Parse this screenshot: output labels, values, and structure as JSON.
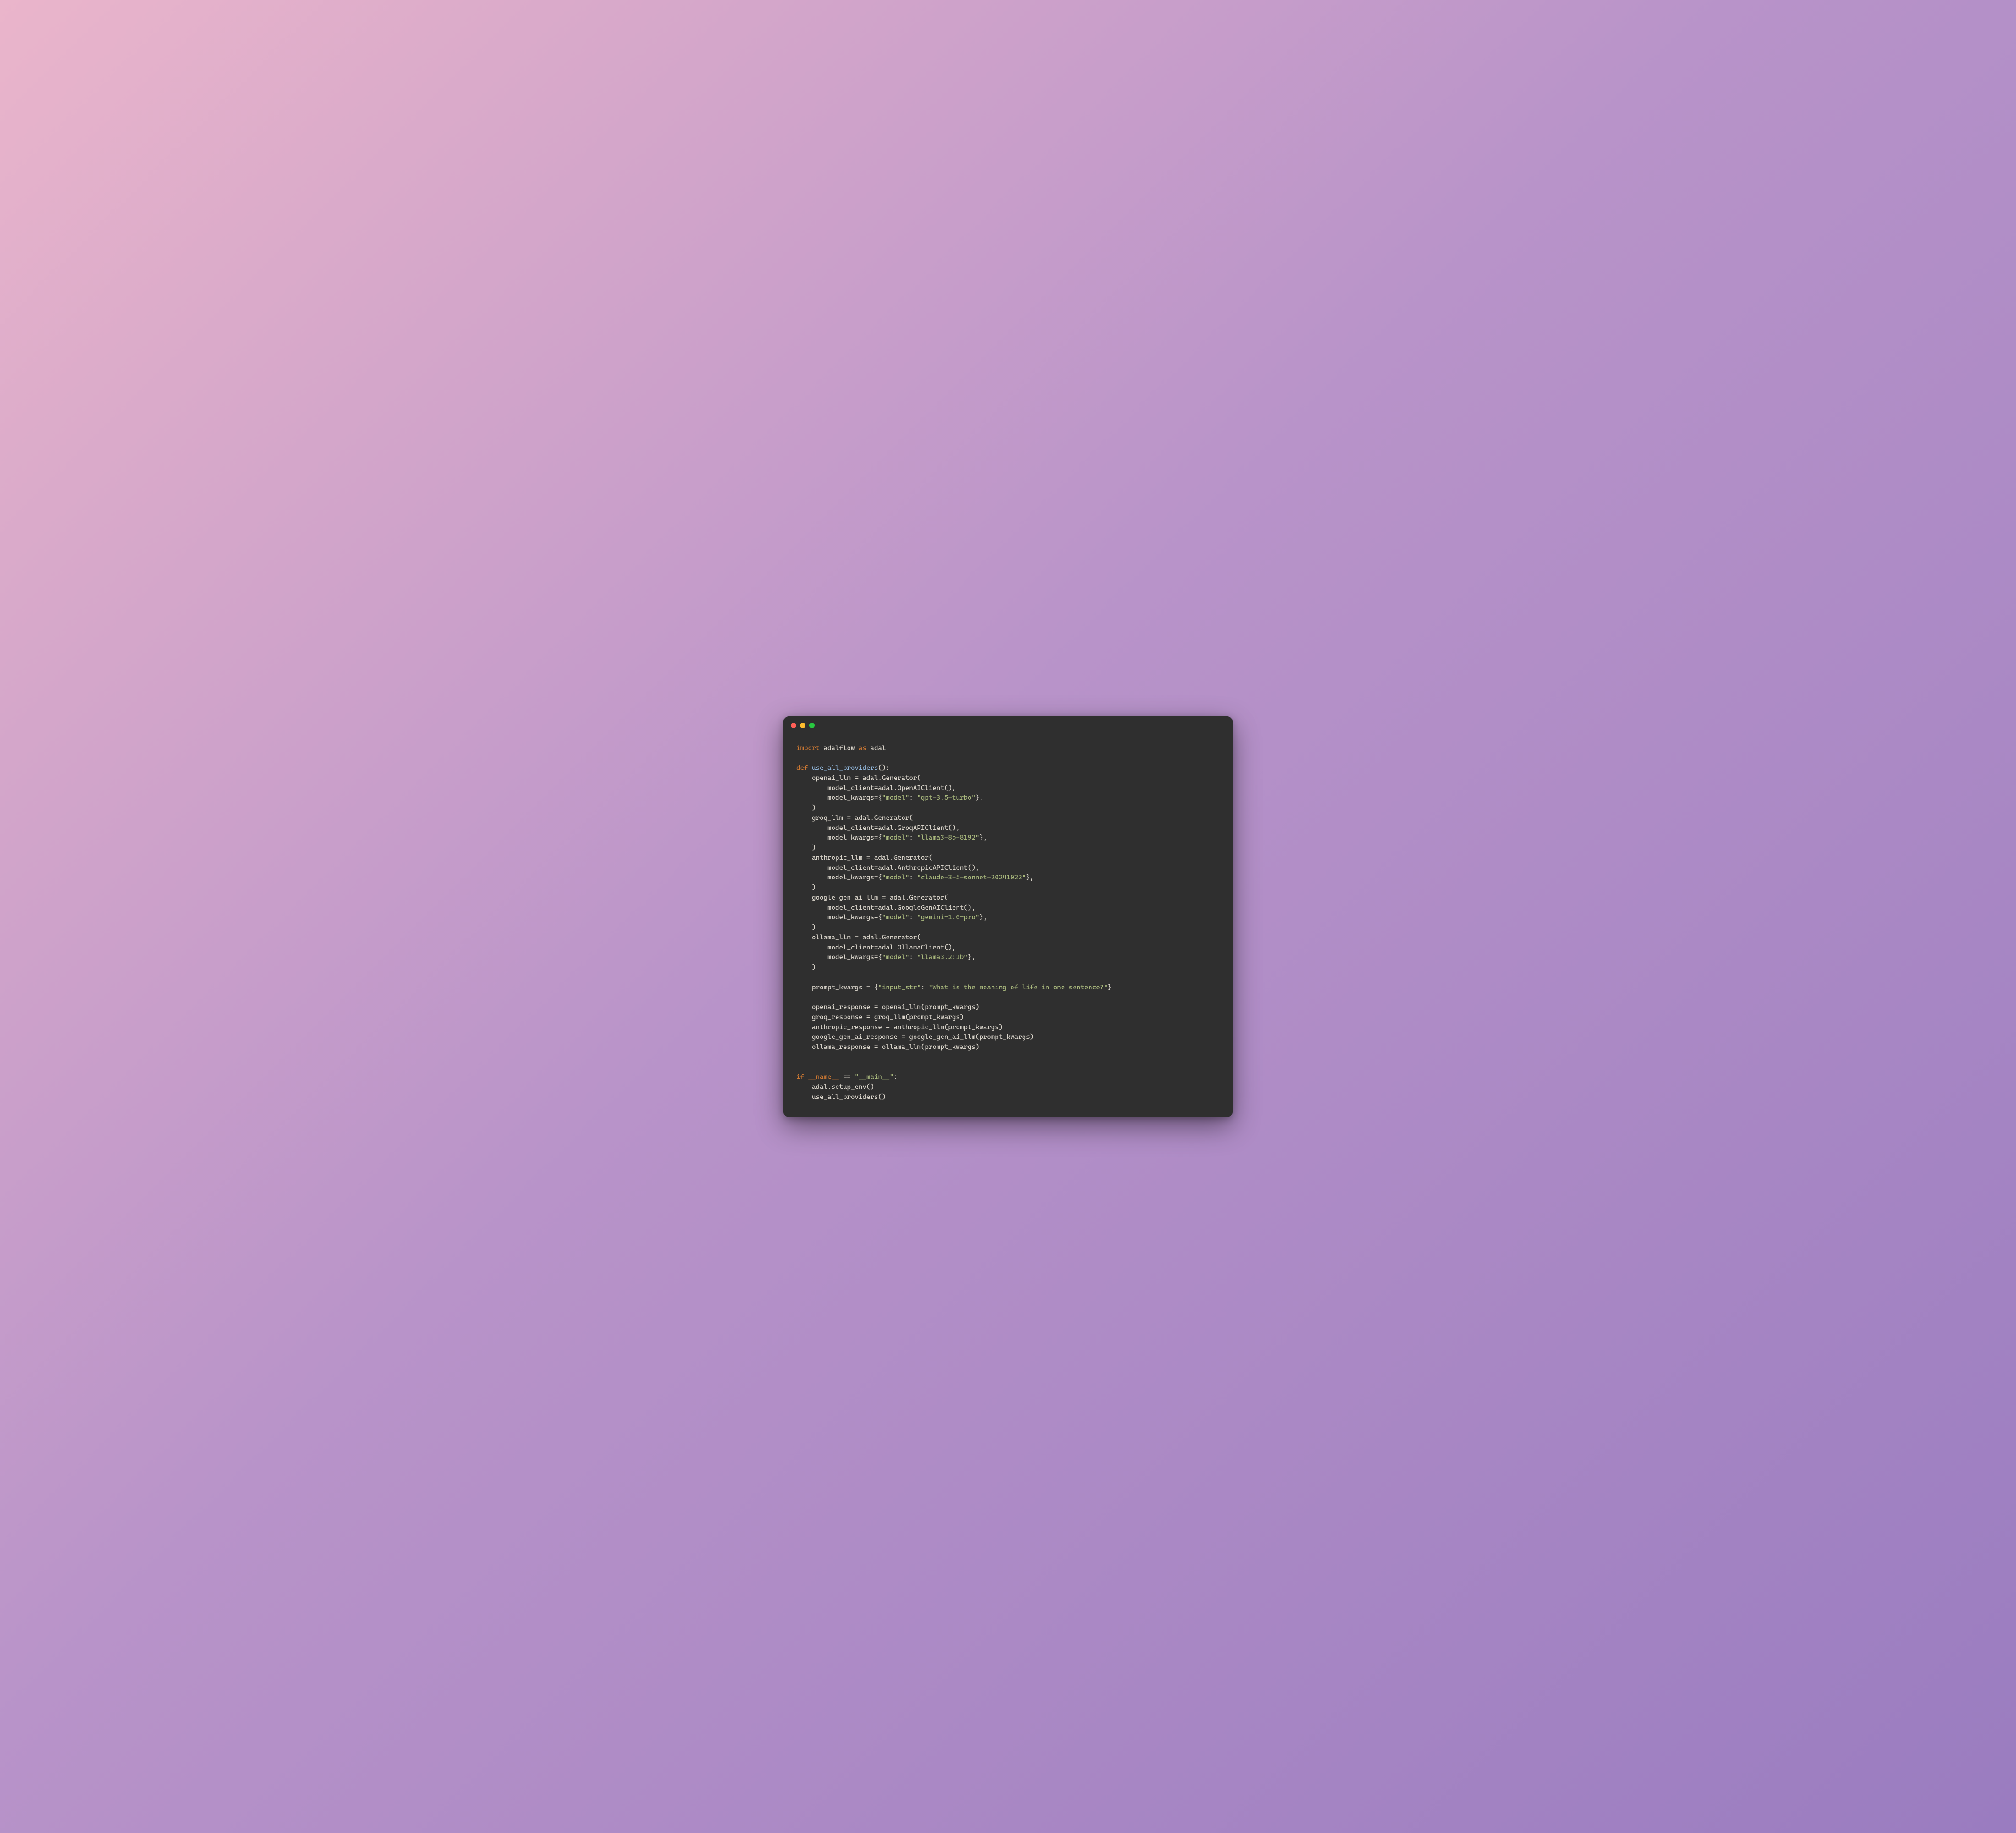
{
  "code": {
    "line1": {
      "kw1": "import",
      "mod": " adalflow ",
      "kw2": "as",
      "alias": " adal"
    },
    "line3": {
      "kw": "def ",
      "fn": "use_all_providers",
      "rest": "():"
    },
    "line4": "    openai_llm = adal.Generator(",
    "line5": "        model_client=adal.OpenAIClient(),",
    "line6a": "        model_kwargs={",
    "line6s1": "\"model\"",
    "line6b": ": ",
    "line6s2": "\"gpt-3.5-turbo\"",
    "line6c": "},",
    "line7": "    )",
    "line8": "    groq_llm = adal.Generator(",
    "line9": "        model_client=adal.GroqAPIClient(),",
    "line10a": "        model_kwargs={",
    "line10s1": "\"model\"",
    "line10b": ": ",
    "line10s2": "\"llama3-8b-8192\"",
    "line10c": "},",
    "line11": "    )",
    "line12": "    anthropic_llm = adal.Generator(",
    "line13": "        model_client=adal.AnthropicAPIClient(),",
    "line14a": "        model_kwargs={",
    "line14s1": "\"model\"",
    "line14b": ": ",
    "line14s2": "\"claude-3-5-sonnet-20241022\"",
    "line14c": "},",
    "line15": "    )",
    "line16": "    google_gen_ai_llm = adal.Generator(",
    "line17": "        model_client=adal.GoogleGenAIClient(),",
    "line18a": "        model_kwargs={",
    "line18s1": "\"model\"",
    "line18b": ": ",
    "line18s2": "\"gemini-1.0-pro\"",
    "line18c": "},",
    "line19": "    )",
    "line20": "    ollama_llm = adal.Generator(",
    "line21": "        model_client=adal.OllamaClient(),",
    "line22a": "        model_kwargs={",
    "line22s1": "\"model\"",
    "line22b": ": ",
    "line22s2": "\"llama3.2:1b\"",
    "line22c": "},",
    "line23": "    )",
    "line25a": "    prompt_kwargs = {",
    "line25s1": "\"input_str\"",
    "line25b": ": ",
    "line25s2": "\"What is the meaning of life in one sentence?\"",
    "line25c": "}",
    "line27": "    openai_response = openai_llm(prompt_kwargs)",
    "line28": "    groq_response = groq_llm(prompt_kwargs)",
    "line29": "    anthropic_response = anthropic_llm(prompt_kwargs)",
    "line30": "    google_gen_ai_response = google_gen_ai_llm(prompt_kwargs)",
    "line31": "    ollama_response = ollama_llm(prompt_kwargs)",
    "line34": {
      "kw": "if ",
      "dun": "__name__",
      "eq": " == ",
      "str": "\"__main__\"",
      "colon": ":"
    },
    "line35": "    adal.setup_env()",
    "line36": "    use_all_providers()"
  }
}
